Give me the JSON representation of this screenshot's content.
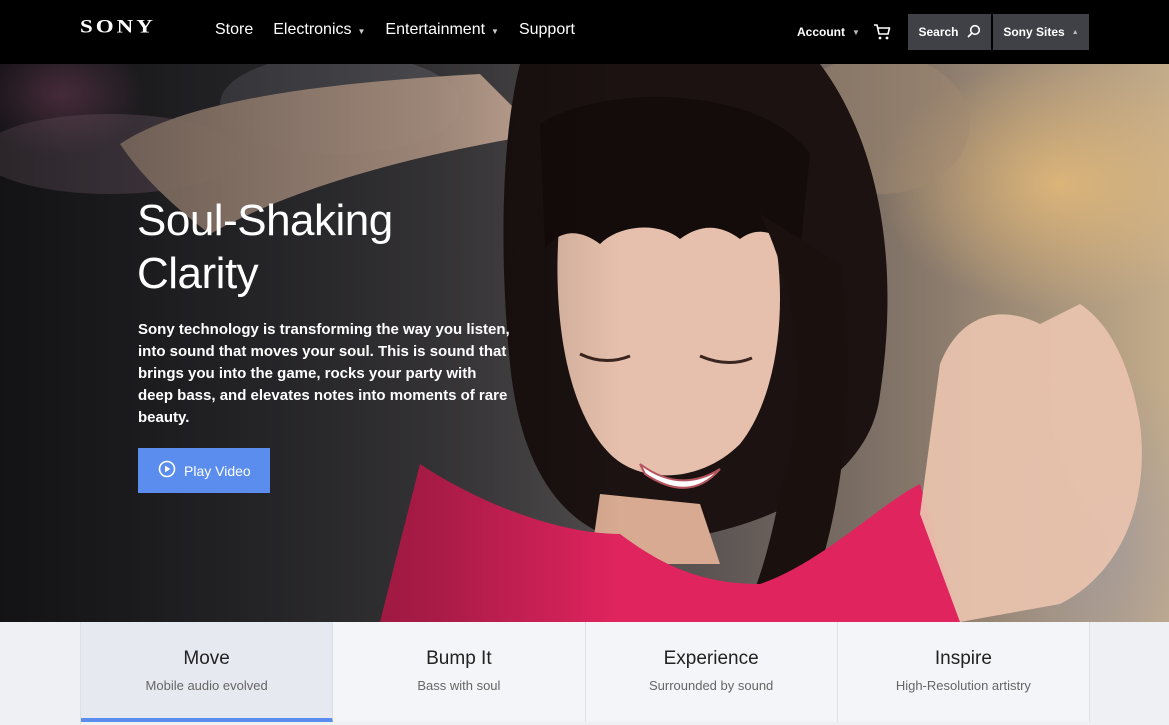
{
  "header": {
    "logo": "SONY",
    "nav": [
      {
        "label": "Store",
        "has_dropdown": false
      },
      {
        "label": "Electronics",
        "has_dropdown": true
      },
      {
        "label": "Entertainment",
        "has_dropdown": true
      },
      {
        "label": "Support",
        "has_dropdown": false
      }
    ],
    "account_label": "Account",
    "cart_icon": "shopping-cart-icon",
    "search_label": "Search",
    "search_icon": "search-icon",
    "sites_label": "Sony Sites"
  },
  "hero": {
    "title_line1": "Soul-Shaking",
    "title_line2": "Clarity",
    "text": "Sony technology is transforming the way you listen, into sound that moves your soul. This is sound that brings you into the game, rocks your party with deep bass, and elevates notes into moments of rare beauty.",
    "play_button_label": "Play Video",
    "play_icon": "play-circle-icon"
  },
  "tabs": [
    {
      "title": "Move",
      "subtitle": "Mobile audio evolved",
      "active": true
    },
    {
      "title": "Bump It",
      "subtitle": "Bass with soul",
      "active": false
    },
    {
      "title": "Experience",
      "subtitle": "Surrounded by sound",
      "active": false
    },
    {
      "title": "Inspire",
      "subtitle": "High-Resolution artistry",
      "active": false
    }
  ],
  "colors": {
    "accent": "#5b8def",
    "header_bg": "#000000",
    "header_button_bg": "#3f4147",
    "tab_bar_bg": "#eef0f4",
    "dress": "#e0245e"
  }
}
